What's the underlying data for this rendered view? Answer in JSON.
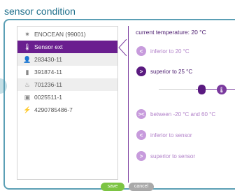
{
  "dialog": {
    "title": "sensor condition"
  },
  "sensor_list": [
    {
      "label": "ENOCEAN (99001)",
      "icon": "gear-icon",
      "state": "normal"
    },
    {
      "label": "Sensor ext",
      "icon": "thermometer-icon",
      "state": "selected"
    },
    {
      "label": "283430-11",
      "icon": "user-icon",
      "state": "alt"
    },
    {
      "label": "391874-11",
      "icon": "phone-icon",
      "state": "normal"
    },
    {
      "label": "701236-11",
      "icon": "heater-icon",
      "state": "alt"
    },
    {
      "label": "0025511-1",
      "icon": "panel-icon",
      "state": "normal"
    },
    {
      "label": "4290785486-7",
      "icon": "lightning-icon",
      "state": "normal"
    }
  ],
  "condition": {
    "current_temperature": "current temperature: 20 °C",
    "options": [
      {
        "label": "inferior to 20 °C",
        "symbol": "<",
        "active": false
      },
      {
        "label": "superior to 25 °C",
        "symbol": ">",
        "active": true
      },
      {
        "label": "between -20 °C and 60 °C",
        "symbol": "><",
        "active": false
      },
      {
        "label": "inferior to sensor",
        "symbol": "<",
        "active": false
      },
      {
        "label": "superior to sensor",
        "symbol": ">",
        "active": false
      }
    ],
    "thermometer_glyph": "🌡"
  },
  "footer": {
    "save_label": "save",
    "cancel_label": "cancel"
  },
  "colors": {
    "accent_purple": "#6a1e8f",
    "frame_blue": "#5b9fb5",
    "save_green": "#7cc443",
    "cancel_grey": "#a9a9a9"
  }
}
